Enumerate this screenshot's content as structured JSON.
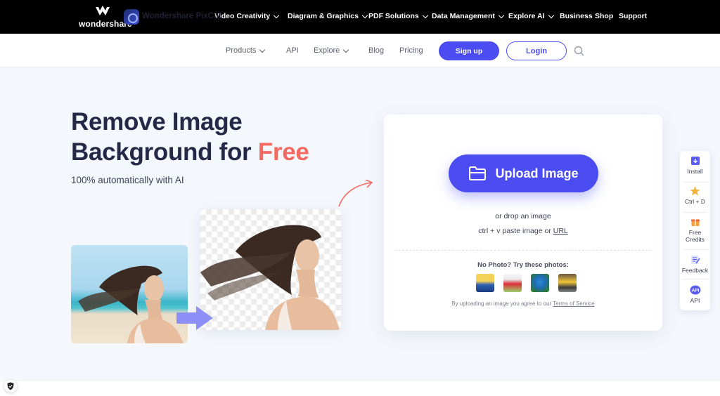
{
  "brand": {
    "name": "wondershare"
  },
  "topnav": {
    "items": [
      {
        "label": "Video Creativity",
        "dropdown": true
      },
      {
        "label": "Diagram & Graphics",
        "dropdown": true
      },
      {
        "label": "PDF Solutions",
        "dropdown": true
      },
      {
        "label": "Data Management",
        "dropdown": true
      },
      {
        "label": "Explore AI",
        "dropdown": true
      },
      {
        "label": "Business",
        "dropdown": false
      },
      {
        "label": "Shop",
        "dropdown": false
      },
      {
        "label": "Support",
        "dropdown": false
      }
    ]
  },
  "subnav": {
    "product_name": "Wondershare PixCut",
    "items": [
      {
        "label": "Products",
        "dropdown": true
      },
      {
        "label": "API",
        "dropdown": false
      },
      {
        "label": "Explore",
        "dropdown": true
      },
      {
        "label": "Blog",
        "dropdown": false
      },
      {
        "label": "Pricing",
        "dropdown": false
      }
    ],
    "signup_label": "Sign up",
    "login_label": "Login"
  },
  "hero": {
    "title_line1": "Remove Image",
    "title_line2_prefix": "Background for ",
    "title_highlight": "Free",
    "subtitle": "100% automatically with AI"
  },
  "upload": {
    "button_label": "Upload Image",
    "drop_text": "or drop an image",
    "paste_text": "ctrl + v paste image or ",
    "url_link": "URL",
    "try_text": "No Photo? Try these photos:",
    "terms_text": "By uploading an image you agree to our ",
    "terms_link": "Terms of Service"
  },
  "side_panel": {
    "items": [
      {
        "label": "Install",
        "icon": "install-icon"
      },
      {
        "label": "Ctrl + D",
        "icon": "star-icon"
      },
      {
        "label": "Free Credits",
        "icon": "gift-icon"
      },
      {
        "label": "Feedback",
        "icon": "feedback-icon"
      },
      {
        "label": "API",
        "icon": "api-icon"
      }
    ]
  },
  "colors": {
    "accent": "#4b4cf2",
    "highlight": "#f26a62",
    "title": "#252947"
  }
}
